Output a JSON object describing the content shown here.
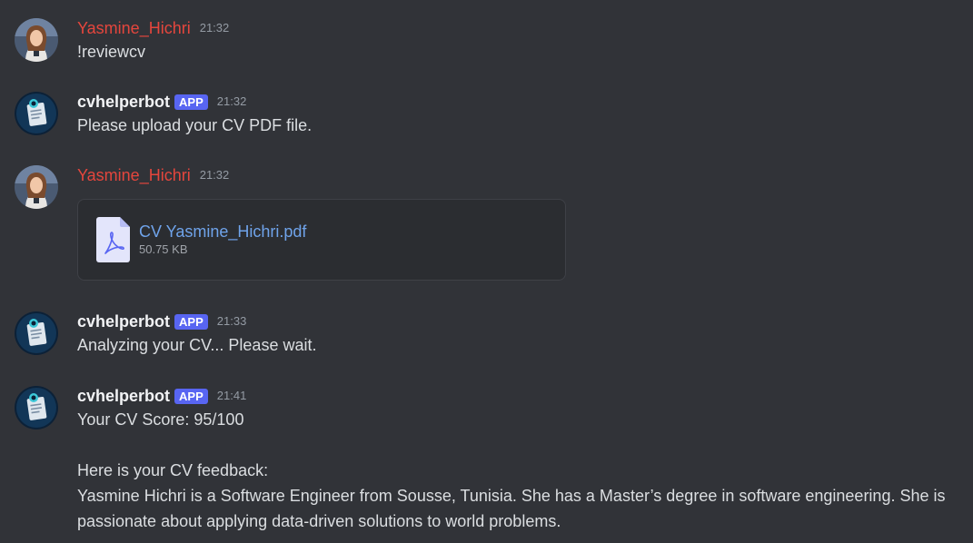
{
  "messages": [
    {
      "author": "Yasmine_Hichri",
      "time": "21:32",
      "text": "!reviewcv"
    },
    {
      "author": "cvhelperbot",
      "badge": "APP",
      "time": "21:32",
      "text": "Please upload your CV PDF file."
    },
    {
      "author": "Yasmine_Hichri",
      "time": "21:32",
      "attachment": {
        "file_name": "CV Yasmine_Hichri.pdf",
        "file_size": "50.75 KB",
        "icon": "pdf-file-icon"
      }
    },
    {
      "author": "cvhelperbot",
      "badge": "APP",
      "time": "21:33",
      "text": "Analyzing your CV... Please wait."
    },
    {
      "author": "cvhelperbot",
      "badge": "APP",
      "time": "21:41",
      "score_line": "Your CV Score: 95/100",
      "feedback_heading": "Here is your CV feedback:",
      "feedback_body": "Yasmine Hichri is a Software Engineer from Sousse, Tunisia. She has a Master’s degree in software engineering. She is passionate about applying data-driven solutions to world problems."
    }
  ],
  "colors": {
    "background": "#313338",
    "user_name": "#e5463d",
    "bot_name": "#f2f3f5",
    "app_badge": "#5865f2",
    "link": "#6fa3ea",
    "timestamp": "#949ba4"
  }
}
